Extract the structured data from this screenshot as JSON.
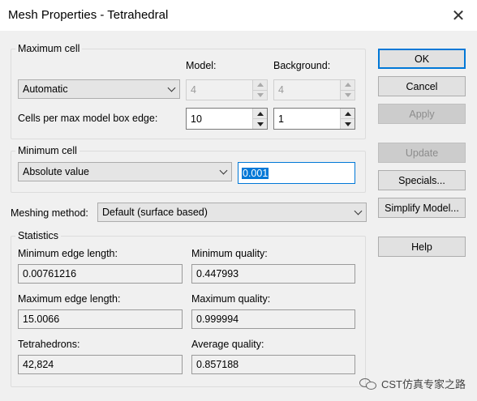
{
  "window": {
    "title": "Mesh Properties - Tetrahedral"
  },
  "maximum_cell": {
    "group_label": "Maximum cell",
    "model_label": "Model:",
    "background_label": "Background:",
    "mode": "Automatic",
    "model_value": "4",
    "background_value": "4",
    "cells_label": "Cells per max model box edge:",
    "cells_model_value": "10",
    "cells_background_value": "1"
  },
  "minimum_cell": {
    "group_label": "Minimum cell",
    "mode": "Absolute value",
    "value": "0.001"
  },
  "meshing": {
    "label": "Meshing method:",
    "value": "Default (surface based)"
  },
  "statistics": {
    "group_label": "Statistics",
    "min_edge_label": "Minimum edge length:",
    "min_edge_value": "0.00761216",
    "min_quality_label": "Minimum quality:",
    "min_quality_value": "0.447993",
    "max_edge_label": "Maximum edge length:",
    "max_edge_value": "15.0066",
    "max_quality_label": "Maximum quality:",
    "max_quality_value": "0.999994",
    "tetra_label": "Tetrahedrons:",
    "tetra_value": "42,824",
    "avg_quality_label": "Average quality:",
    "avg_quality_value": "0.857188"
  },
  "buttons": {
    "ok": "OK",
    "cancel": "Cancel",
    "apply": "Apply",
    "update": "Update",
    "specials": "Specials...",
    "simplify": "Simplify Model...",
    "help": "Help"
  },
  "watermark": {
    "text": "CST仿真专家之路"
  },
  "colors": {
    "accent": "#0078d7",
    "disabled_button": "#cccccc"
  }
}
